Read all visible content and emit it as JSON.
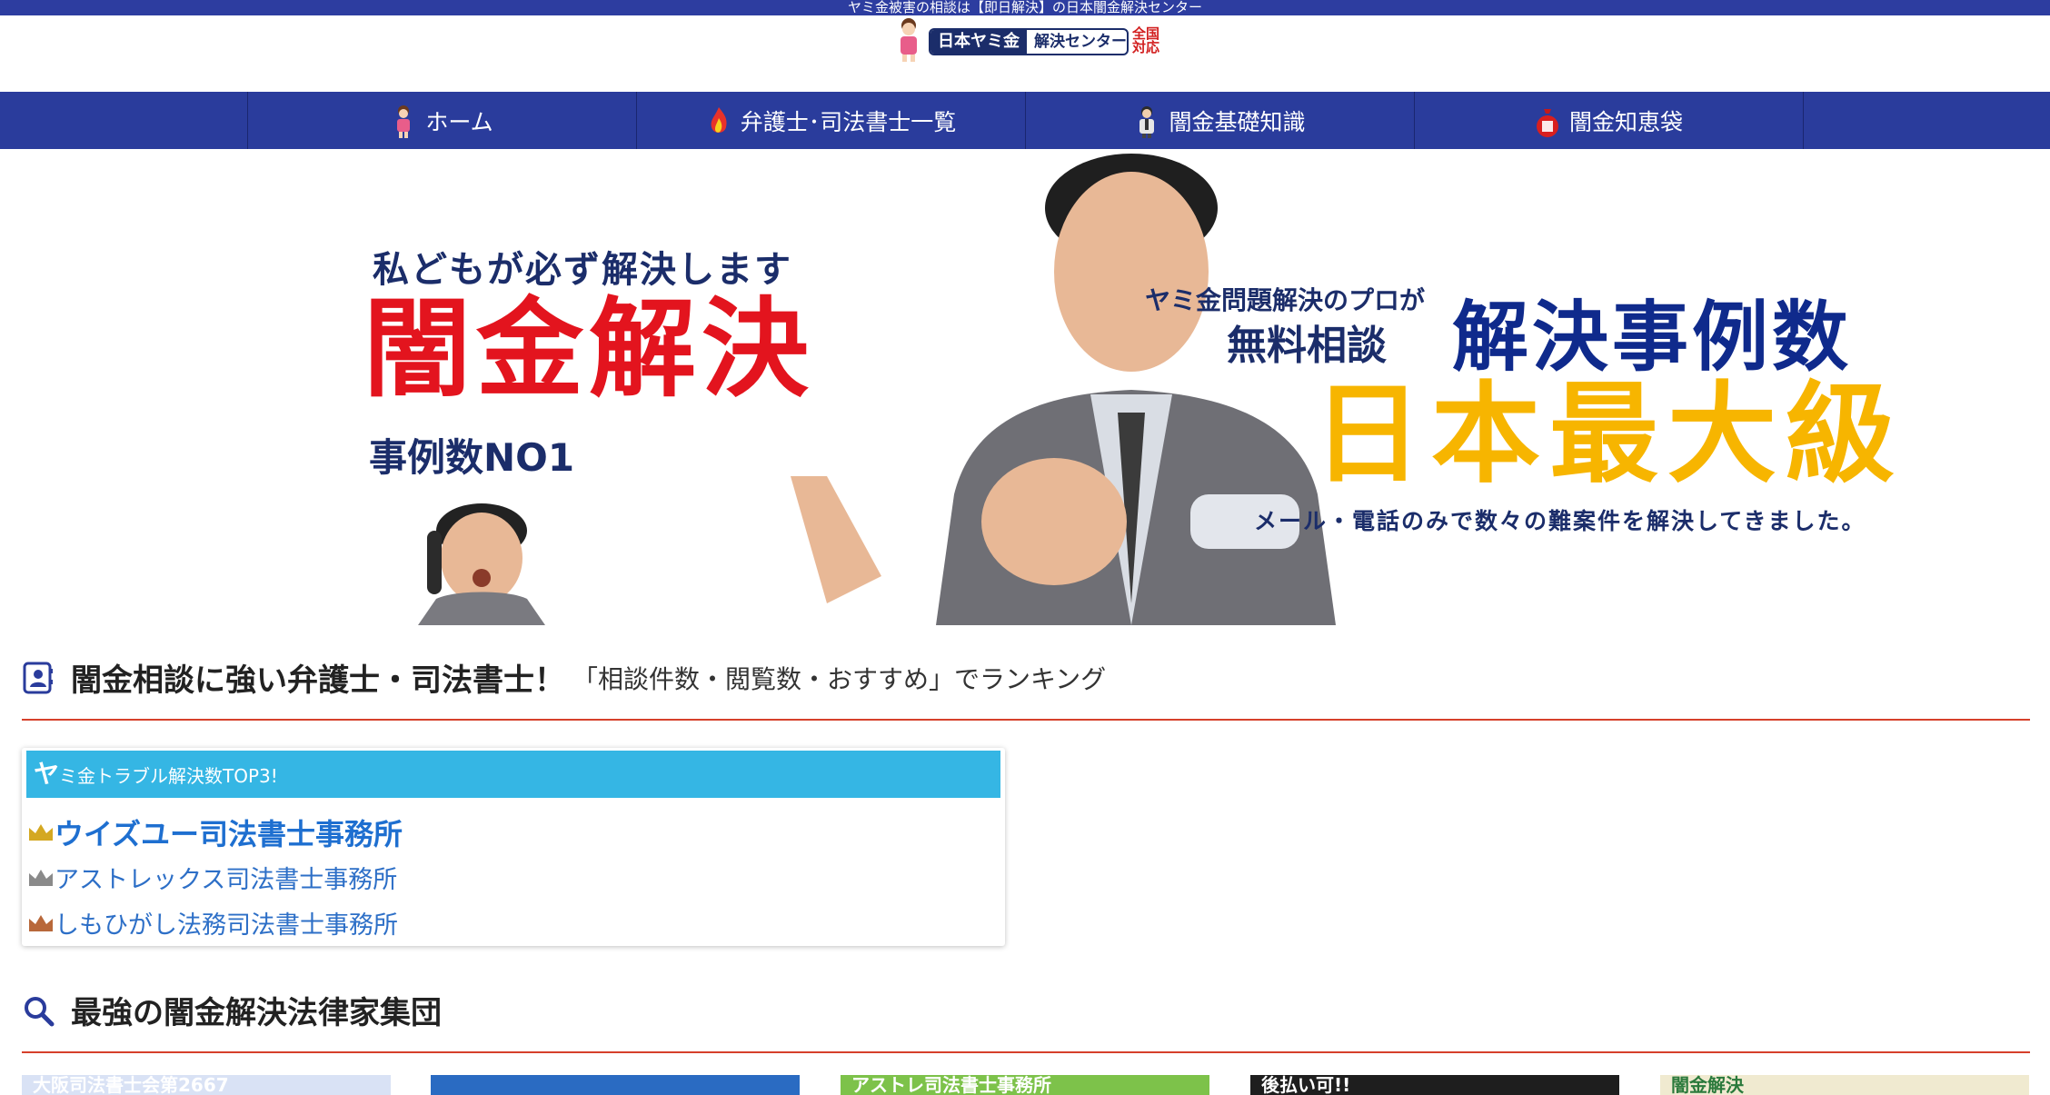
{
  "topbar": {
    "notice": "ヤミ金被害の相談は【即日解決】の日本闇金解決センター"
  },
  "logo": {
    "dark": "日本ヤミ金",
    "light": "解決センター",
    "badge_line1": "全国",
    "badge_line2": "対応"
  },
  "nav": {
    "items": [
      {
        "label": "ホーム",
        "icon": "girl-icon"
      },
      {
        "label": "弁護士･司法書士一覧",
        "icon": "fire-icon"
      },
      {
        "label": "闇金基礎知識",
        "icon": "man-icon"
      },
      {
        "label": "闇金知恵袋",
        "icon": "bag-icon"
      }
    ]
  },
  "hero": {
    "line1": "私どもが必ず解決します",
    "line2": "闇金解決",
    "line3": "事例数NO1",
    "right1": "ヤミ金問題解決のプロが",
    "right2": "無料相談",
    "right3": "解決事例数",
    "right4": "日本最大級",
    "right5": "メール・電話のみで数々の難案件を解決してきました。"
  },
  "section1": {
    "title": "闇金相談に強い弁護士・司法書士！",
    "subtitle": "「相談件数・閲覧数・おすすめ」でランキング"
  },
  "ranking": {
    "header_big": "ヤ",
    "header_rest": "ミ金トラブル解決数TOP3!",
    "items": [
      {
        "name": "ウイズユー司法書士事務所",
        "rank_color": "#d4a821"
      },
      {
        "name": "アストレックス司法書士事務所",
        "rank_color": "#8a8a8a"
      },
      {
        "name": "しもひがし法務司法書士事務所",
        "rank_color": "#b8683a"
      }
    ]
  },
  "section2": {
    "title": "最強の闇金解決法律家集団"
  },
  "cards": [
    {
      "text": "大阪司法書士会第2667",
      "bg": "#d9e2f5",
      "fg": "#ffffff"
    },
    {
      "text": "",
      "bg": "#2a6bc2",
      "fg": "#ffffff"
    },
    {
      "text": "アストレ司法書士事務所",
      "bg": "#7dc24a",
      "fg": "#ffffff"
    },
    {
      "text": "後払い可!!",
      "bg": "#1e1e1e",
      "fg": "#ffffff"
    },
    {
      "text": "闇金解決",
      "bg": "#f0ead0",
      "fg": "#2b7a3c"
    }
  ]
}
